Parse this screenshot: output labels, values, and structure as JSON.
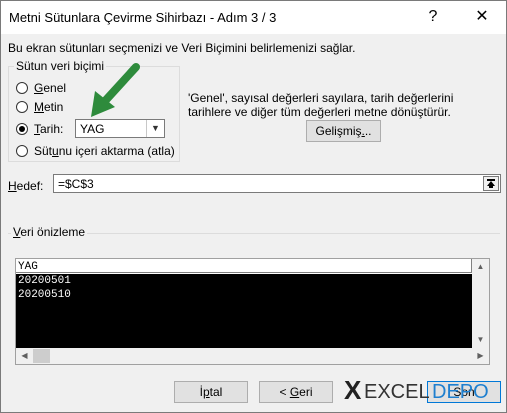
{
  "dialog": {
    "title": "Metni Sütunlara Çevirme Sihirbazı - Adım 3 / 3",
    "help_glyph": "?",
    "close_glyph": "✕",
    "intro": "Bu ekran sütunları seçmenizi ve Veri Biçimini belirlemenizi  sağlar."
  },
  "format_group": {
    "legend": "Sütun veri biçimi",
    "options": [
      {
        "pre": "",
        "u": "G",
        "post": "enel",
        "selected": false
      },
      {
        "pre": "",
        "u": "M",
        "post": "etin",
        "selected": false
      },
      {
        "pre": "",
        "u": "T",
        "post": "arih:",
        "selected": true
      },
      {
        "pre": "Süt",
        "u": "u",
        "post": "nu içeri aktarma (atla)",
        "selected": false
      }
    ],
    "date_format": "YAG"
  },
  "description": "'Genel', sayısal değerleri sayılara, tarih değerlerini tarihlere ve diğer tüm değerleri metne dönüştürür.",
  "advanced_button": {
    "pre": "Gelişmiş",
    "u": ".",
    "post": ".."
  },
  "destination": {
    "label_u": "H",
    "label_rest": "edef:",
    "value": "=$C$3",
    "collapse_icon": "collapse-dialog-icon"
  },
  "preview": {
    "legend_u": "V",
    "legend_rest": "eri önizleme",
    "header": "YAG",
    "rows": [
      "20200501",
      "20200510"
    ]
  },
  "footer": {
    "cancel": {
      "pre": "İ",
      "u": "p",
      "post": "tal"
    },
    "back": {
      "pre": "< ",
      "u": "G",
      "post": "eri"
    },
    "finish": "Son"
  },
  "watermark": "XEXCELDEPO",
  "colors": {
    "arrow": "#2e8b3c",
    "watermark_depo": "#1e7fcf"
  }
}
